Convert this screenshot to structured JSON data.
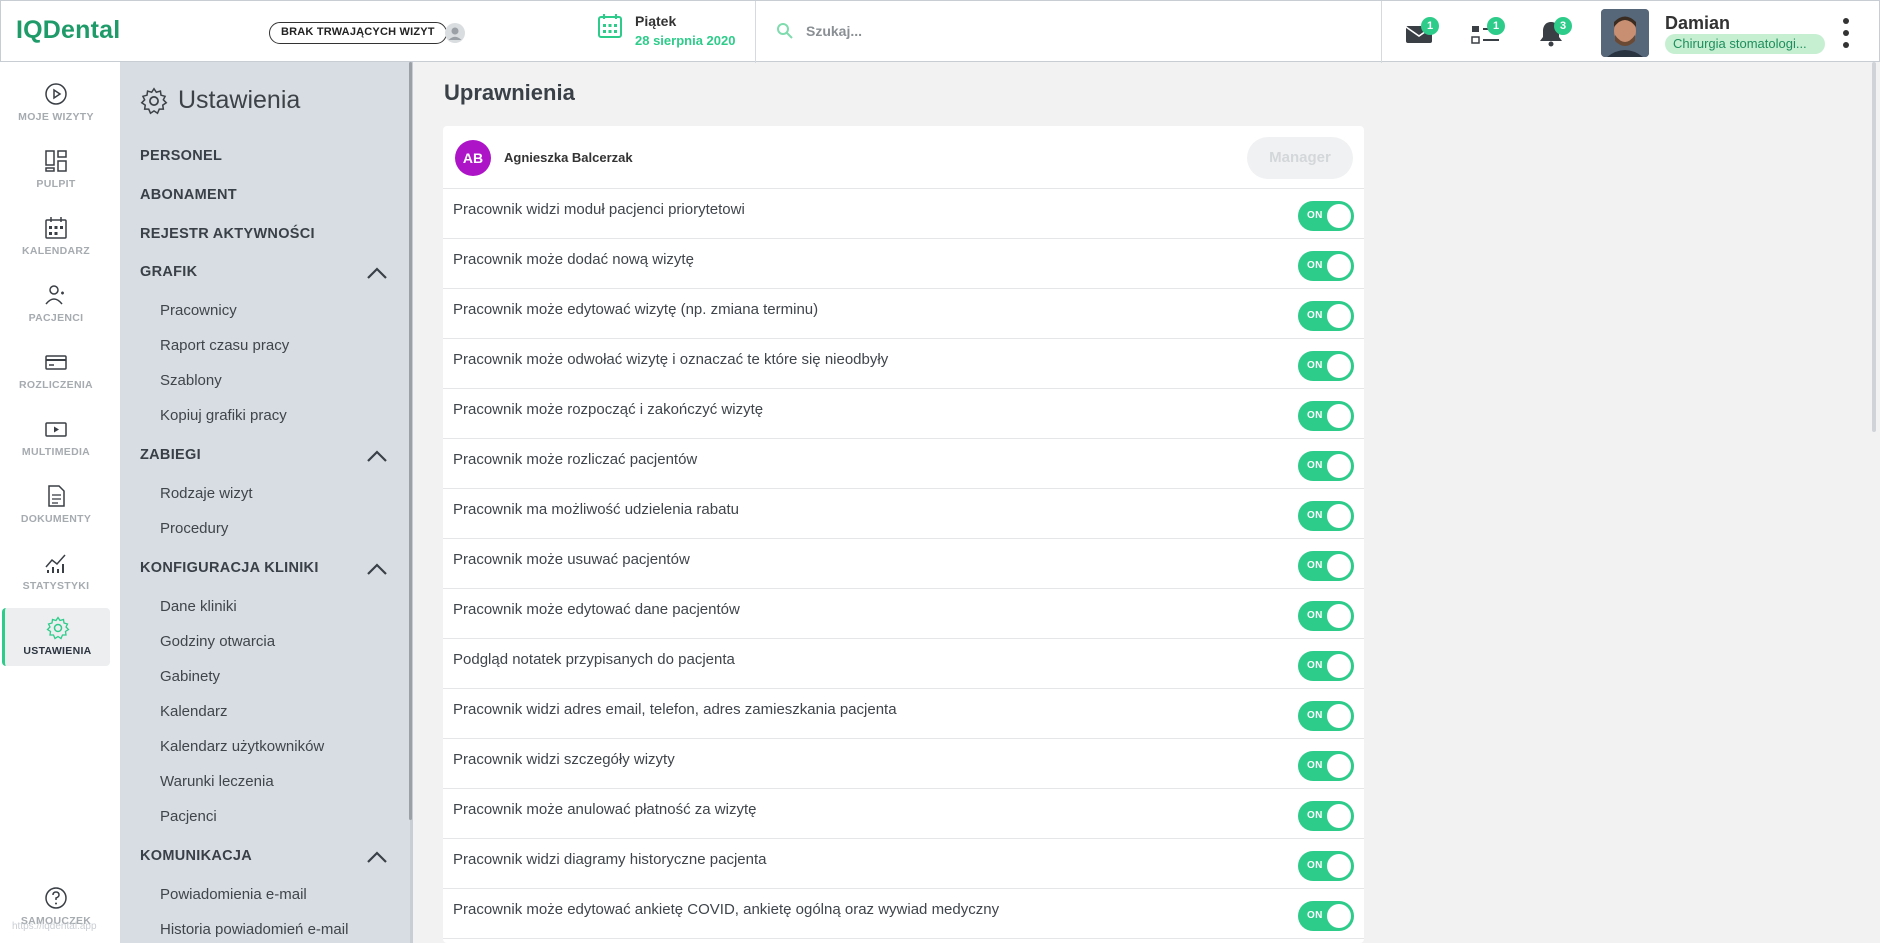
{
  "app": {
    "logo": "IQDental",
    "visit_status": "BRAK TRWAJĄCYCH WIZYT",
    "date_day": "Piątek",
    "date_full": "28 sierpnia 2020",
    "search_placeholder": "Szukaj...",
    "badges": {
      "messages": "1",
      "tasks": "1",
      "notifications": "3"
    },
    "user_name": "Damian",
    "user_role": "Chirurgia stomatologi...",
    "url_hint": "https://iqdental.app"
  },
  "leftnav": [
    {
      "label": "MOJE WIZYTY",
      "icon": "play-circle-icon"
    },
    {
      "label": "PULPIT",
      "icon": "dashboard-icon"
    },
    {
      "label": "KALENDARZ",
      "icon": "calendar-icon"
    },
    {
      "label": "PACJENCI",
      "icon": "patients-icon"
    },
    {
      "label": "ROZLICZENIA",
      "icon": "card-icon"
    },
    {
      "label": "MULTIMEDIA",
      "icon": "media-icon"
    },
    {
      "label": "DOKUMENTY",
      "icon": "document-icon"
    },
    {
      "label": "STATYSTYKI",
      "icon": "stats-icon"
    },
    {
      "label": "USTAWIENIA",
      "icon": "gear-icon"
    },
    {
      "label": "SAMOUCZEK",
      "icon": "help-icon"
    }
  ],
  "settings": {
    "title": "Ustawienia",
    "personel": "PERSONEL",
    "abonament": "ABONAMENT",
    "rejestr": "REJESTR AKTYWNOŚCI",
    "grafik": {
      "header": "GRAFIK",
      "items": [
        "Pracownicy",
        "Raport czasu pracy",
        "Szablony",
        "Kopiuj grafiki pracy"
      ]
    },
    "zabiegi": {
      "header": "ZABIEGI",
      "items": [
        "Rodzaje wizyt",
        "Procedury"
      ]
    },
    "konfiguracja": {
      "header": "KONFIGURACJA KLINIKI",
      "items": [
        "Dane kliniki",
        "Godziny otwarcia",
        "Gabinety",
        "Kalendarz",
        "Kalendarz użytkowników",
        "Warunki leczenia",
        "Pacjenci"
      ]
    },
    "komunikacja": {
      "header": "KOMUNIKACJA",
      "items": [
        "Powiadomienia e-mail",
        "Historia powiadomień e-mail"
      ]
    }
  },
  "main": {
    "title": "Uprawnienia",
    "employee_initials": "AB",
    "employee_name": "Agnieszka Balcerzak",
    "role_button": "Manager",
    "toggle_label": "ON",
    "permissions": [
      "Pracownik widzi moduł pacjenci priorytetowi",
      "Pracownik może dodać nową wizytę",
      "Pracownik może edytować wizytę (np. zmiana terminu)",
      "Pracownik może odwołać wizytę i oznaczać te które się nieodbyły",
      "Pracownik może rozpocząć i zakończyć wizytę",
      "Pracownik może rozliczać pacjentów",
      "Pracownik ma możliwość udzielenia rabatu",
      "Pracownik może usuwać pacjentów",
      "Pracownik może edytować dane pacjentów",
      "Podgląd notatek przypisanych do pacjenta",
      "Pracownik widzi adres email, telefon, adres zamieszkania pacjenta",
      "Pracownik widzi szczegóły wizyty",
      "Pracownik może anulować płatność za wizytę",
      "Pracownik widzi diagramy historyczne pacjenta",
      "Pracownik może edytować ankietę COVID, ankietę ogólną oraz wywiad medyczny"
    ]
  }
}
